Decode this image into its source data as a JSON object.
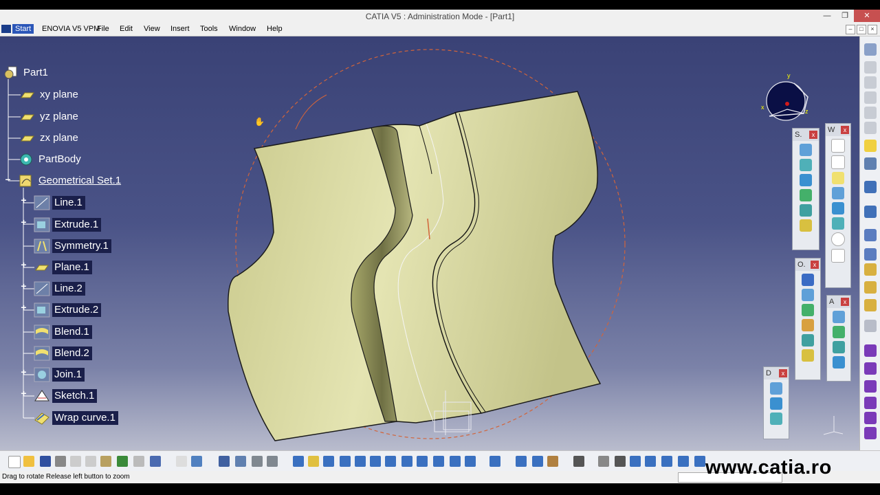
{
  "window": {
    "title": "CATIA V5 : Administration Mode - [Part1]"
  },
  "menubar": {
    "start": "Start",
    "items": [
      "ENOVIA V5 VPM",
      "File",
      "Edit",
      "View",
      "Insert",
      "Tools",
      "Window",
      "Help"
    ]
  },
  "tree": {
    "root": "Part1",
    "nodes": [
      {
        "label": "xy plane",
        "icon": "plane-icon"
      },
      {
        "label": "yz plane",
        "icon": "plane-icon"
      },
      {
        "label": "zx plane",
        "icon": "plane-icon"
      },
      {
        "label": "PartBody",
        "icon": "partbody-icon"
      },
      {
        "label": "Geometrical Set.1",
        "icon": "geometrical-set-icon"
      },
      {
        "label": "Line.1",
        "icon": "line-icon"
      },
      {
        "label": "Extrude.1",
        "icon": "extrude-icon"
      },
      {
        "label": "Symmetry.1",
        "icon": "symmetry-icon"
      },
      {
        "label": "Plane.1",
        "icon": "plane-icon"
      },
      {
        "label": "Line.2",
        "icon": "line-icon"
      },
      {
        "label": "Extrude.2",
        "icon": "extrude-icon"
      },
      {
        "label": "Blend.1",
        "icon": "blend-icon"
      },
      {
        "label": "Blend.2",
        "icon": "blend-icon"
      },
      {
        "label": "Join.1",
        "icon": "join-icon"
      },
      {
        "label": "Sketch.1",
        "icon": "sketch-icon"
      },
      {
        "label": "Wrap curve.1",
        "icon": "wrap-curve-icon"
      }
    ]
  },
  "panels": {
    "s": "S.",
    "w": "W",
    "o": "O.",
    "a": "A",
    "d": "D",
    "close": "x"
  },
  "compass": {
    "x": "x",
    "y": "y",
    "z": "z"
  },
  "statusbar": {
    "message": "Drag to rotate  Release left button to zoom"
  },
  "watermark": "www.catia.ro"
}
